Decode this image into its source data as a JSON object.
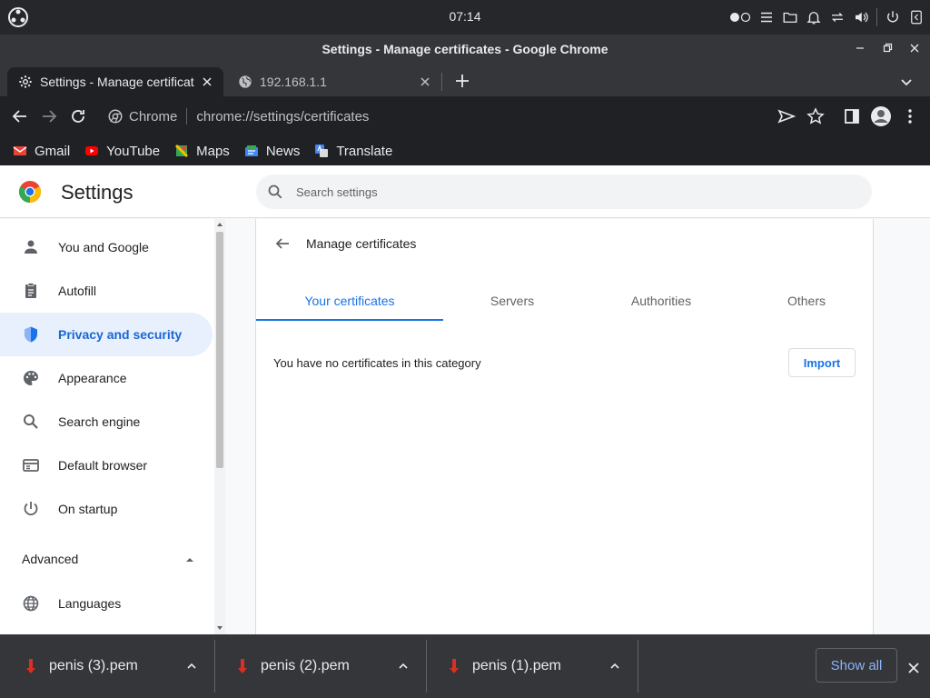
{
  "os": {
    "clock": "07:14"
  },
  "window": {
    "title": "Settings - Manage certificates - Google Chrome"
  },
  "tabs": [
    {
      "label": "Settings - Manage certificates",
      "icon": "gear-icon",
      "active": true
    },
    {
      "label": "192.168.1.1",
      "icon": "globe-icon",
      "active": false
    }
  ],
  "omnibox": {
    "chip": "Chrome",
    "url": "chrome://settings/certificates"
  },
  "bookmarks": [
    {
      "label": "Gmail",
      "icon": "gmail-icon",
      "color": "#ea4335"
    },
    {
      "label": "YouTube",
      "icon": "youtube-icon",
      "color": "#ff0000"
    },
    {
      "label": "Maps",
      "icon": "maps-icon",
      "color": "#34a853"
    },
    {
      "label": "News",
      "icon": "news-icon",
      "color": "#4285f4"
    },
    {
      "label": "Translate",
      "icon": "translate-icon",
      "color": "#4285f4"
    }
  ],
  "settings": {
    "title": "Settings",
    "search_placeholder": "Search settings",
    "nav": [
      {
        "label": "You and Google",
        "icon": "person-icon"
      },
      {
        "label": "Autofill",
        "icon": "clipboard-icon"
      },
      {
        "label": "Privacy and security",
        "icon": "shield-icon",
        "selected": true
      },
      {
        "label": "Appearance",
        "icon": "palette-icon"
      },
      {
        "label": "Search engine",
        "icon": "search-icon"
      },
      {
        "label": "Default browser",
        "icon": "browser-icon"
      },
      {
        "label": "On startup",
        "icon": "power-icon"
      }
    ],
    "advanced_label": "Advanced",
    "languages_label": "Languages"
  },
  "certificates": {
    "title": "Manage certificates",
    "tabs": [
      {
        "label": "Your certificates",
        "active": true
      },
      {
        "label": "Servers"
      },
      {
        "label": "Authorities"
      },
      {
        "label": "Others"
      }
    ],
    "empty_message": "You have no certificates in this category",
    "import_label": "Import"
  },
  "downloads": {
    "items": [
      {
        "name": "penis (3).pem"
      },
      {
        "name": "penis (2).pem"
      },
      {
        "name": "penis (1).pem"
      }
    ],
    "show_all_label": "Show all"
  },
  "colors": {
    "accent": "#1a73e8",
    "selected_bg": "#e8f0fe"
  }
}
